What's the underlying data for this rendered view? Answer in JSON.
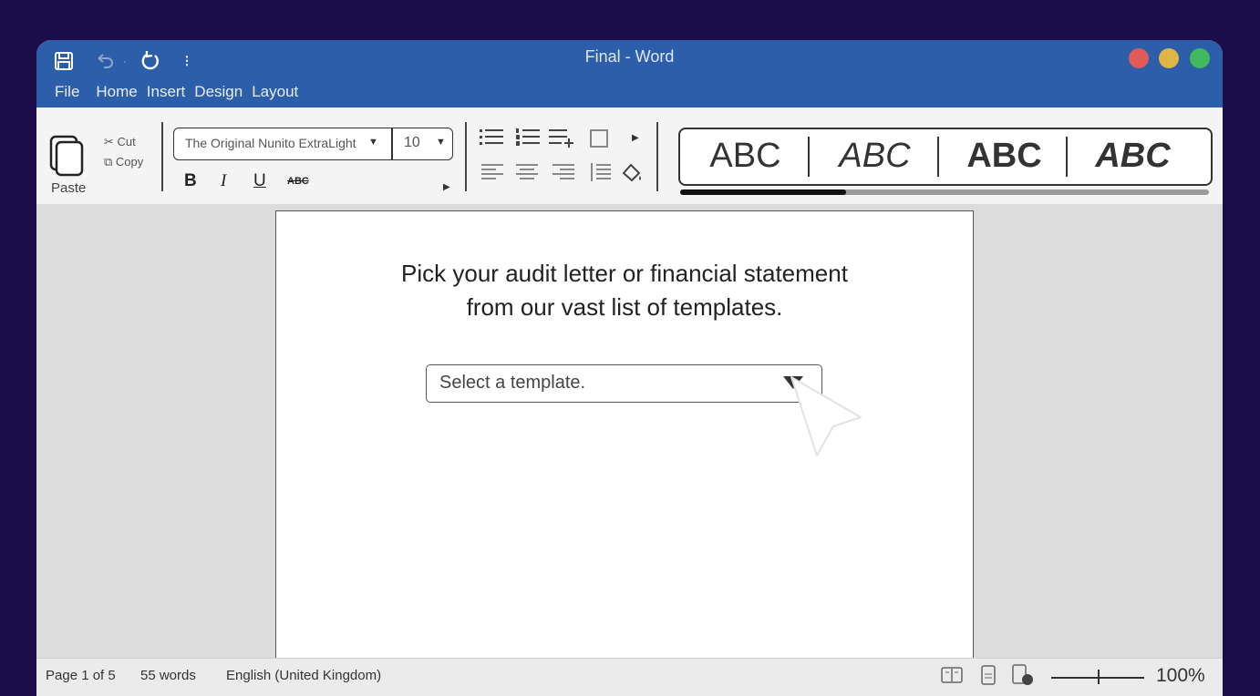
{
  "window": {
    "title": "Final - Word",
    "traffic_lights": {
      "close": "#e05a5a",
      "minimize": "#e0b548",
      "maximize": "#43b85c"
    }
  },
  "quick_access": {
    "save_icon": "save-icon",
    "undo_icon": "undo-icon",
    "redo_icon": "redo-icon",
    "more_icon": "more-icon"
  },
  "menu": [
    "File",
    "Home",
    "Insert",
    "Design",
    "Layout"
  ],
  "ribbon": {
    "paste_label": "Paste",
    "cut_label": "Cut",
    "copy_label": "Copy",
    "font_name": "The Original Nunito ExtraLight",
    "font_size": "10",
    "bold": "B",
    "italic": "I",
    "underline": "U",
    "strikethrough": "ABC",
    "styles": [
      "ABC",
      "ABC",
      "ABC",
      "ABC"
    ]
  },
  "document": {
    "heading_line1": "Pick your audit letter or financial statement",
    "heading_line2": "from our vast list of templates.",
    "select_placeholder": "Select a template."
  },
  "status": {
    "page": "Page 1 of 5",
    "words": "55 words",
    "language": "English (United Kingdom)",
    "zoom": "100%"
  }
}
